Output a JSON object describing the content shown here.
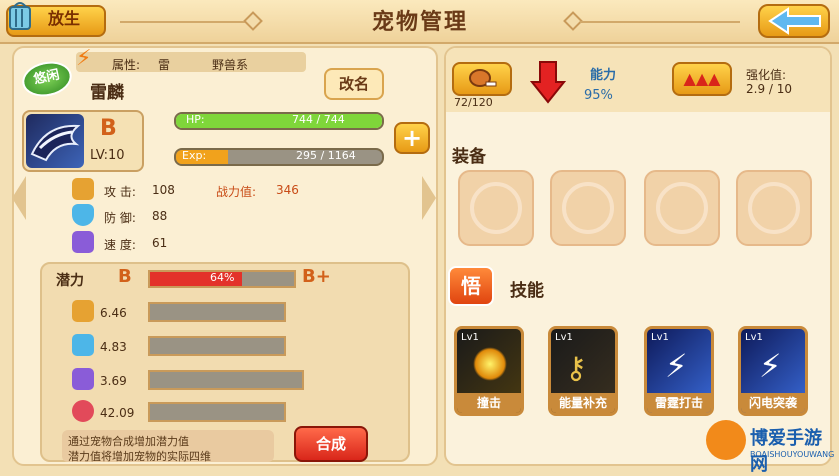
{
  "header": {
    "title": "宠物管理",
    "release_label": "放生"
  },
  "pet": {
    "mood": "悠闲",
    "attribute_label": "属性:",
    "element": "雷",
    "family": "野兽系",
    "name": "雷麟",
    "rename_label": "改名",
    "grade": "B",
    "level": "LV:10",
    "hp_label": "HP:",
    "hp_value": "744 / 744",
    "hp_fraction": 1.0,
    "exp_label": "Exp:",
    "exp_value": "295 / 1164",
    "exp_fraction": 0.253
  },
  "stats": {
    "attack_label": "攻 击:",
    "attack": "108",
    "power_label": "战力值:",
    "power": "346",
    "defense_label": "防 御:",
    "defense": "88",
    "speed_label": "速 度:",
    "speed": "61"
  },
  "potential": {
    "label": "潜力",
    "current_grade": "B",
    "next_grade": "B+",
    "percent_text": "64%",
    "fraction": 0.64,
    "rows": [
      "6.46",
      "4.83",
      "3.69",
      "42.09"
    ],
    "hint_line1": "通过宠物合成增加潜力值",
    "hint_line2": "潜力值将增加宠物的实际四维",
    "synth_label": "合成"
  },
  "right": {
    "food_count": "72/120",
    "ability_label": "能力",
    "ability_value": "95%",
    "enhance_label": "强化值:",
    "enhance_value": "2.9 / 10",
    "equip_title": "装备",
    "skill_badge": "悟",
    "skill_title": "技能",
    "skills": [
      {
        "lv": "Lv1",
        "name": "撞击"
      },
      {
        "lv": "Lv1",
        "name": "能量补充"
      },
      {
        "lv": "Lv1",
        "name": "雷霆打击"
      },
      {
        "lv": "Lv1",
        "name": "闪电突袭"
      }
    ]
  },
  "watermark": {
    "brand": "博爱手游网",
    "domain": "BOAISHOUYOUWANG"
  },
  "colors": {
    "hp": "#7fd63a",
    "exp": "#f1a21c",
    "potential": "#e3322a",
    "accent": "#e79a16"
  }
}
